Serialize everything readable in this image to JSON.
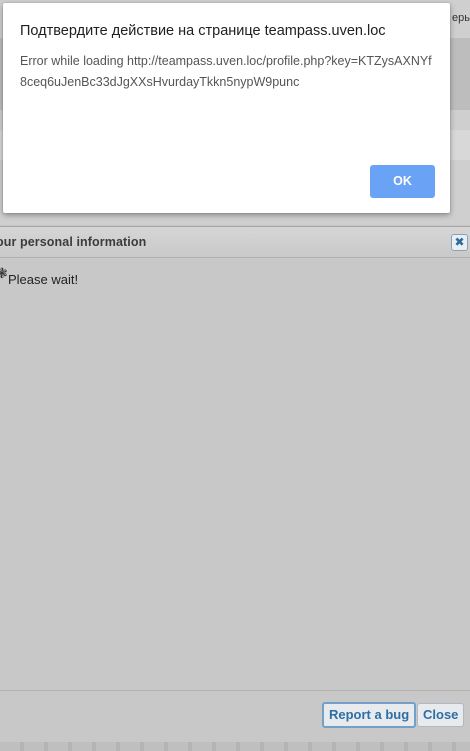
{
  "background_page": {
    "top_right_text": "ерь"
  },
  "profile_dialog": {
    "title": "our personal information",
    "close_icon_glyph": "✖",
    "wait_icon_glyph": "❃",
    "wait_text": "Please wait!",
    "buttons": {
      "report_bug": "Report a bug",
      "close": "Close"
    }
  },
  "confirm_dialog": {
    "title": "Подтвердите действие на странице teampass.uven.loc",
    "message": "Error while loading http://teampass.uven.loc/profile.php?key=KTZysAXNYf8ceq6uJenBc33dJgXXsHvurdayTkkn5nypW9punc",
    "ok_label": "OK",
    "ok_color": "#6aa2f6"
  }
}
